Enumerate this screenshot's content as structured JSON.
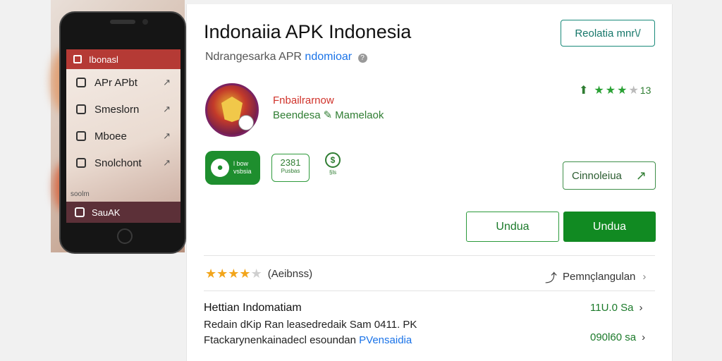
{
  "phone": {
    "header_label": "Ibonasl",
    "menu": [
      {
        "label": "APr APbt"
      },
      {
        "label": "Smeslorn"
      },
      {
        "label": "Mboee"
      },
      {
        "label": "Snolchont"
      }
    ],
    "small_text": "soolm",
    "footer_label": "SauAK"
  },
  "app": {
    "title": "Indonaiia APK Indonesia",
    "subtitle_text": "Ndrangesarka APR",
    "subtitle_link": "ndomioar",
    "related_button": "Reolatia mnr\\/",
    "developer": "Fnbailrarnow",
    "category": "Beendesa",
    "category_extra": "Mamelaok",
    "top_rating_count": "13",
    "badge_green_line1": "l bow",
    "badge_green_line2": "vsbsia",
    "badge_outline_value": "2381",
    "badge_outline_sub": "Pusbas",
    "badge_plain_sub": "§ls",
    "connect_button": "Cinnoleiua",
    "install_outline": "Undua",
    "install_fill": "Undua",
    "rating_text": "(Aeibnss)",
    "share_label": "Pemnçlangulan",
    "info_title": "Hettian Indomatiam",
    "info_line1": "Redain dKip Ran leasedredaik Sam 0411. PK",
    "info_line2_text": "Ftackarynenkainadecl esoundan",
    "info_line2_link": "PVensaidia",
    "size_primary": "11U.0 Sa",
    "size_secondary": "090l60 sa"
  },
  "colors": {
    "accent_green": "#118a22",
    "teal": "#1a8a7a",
    "header_red": "#b53a35",
    "link_blue": "#1a73e8",
    "star_gold": "#f2a51b"
  }
}
